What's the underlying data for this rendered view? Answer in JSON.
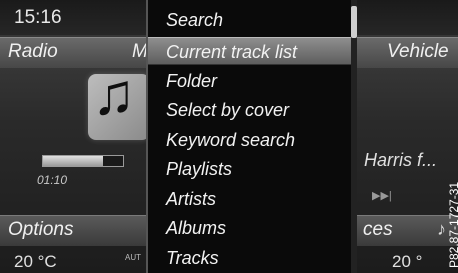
{
  "header": {
    "clock": "15:16"
  },
  "left_panel": {
    "title": "Radio",
    "title_partial": "M",
    "track_time": "01:10",
    "progress": 0.75,
    "options_label": "Options",
    "temperature": "20 °C",
    "auto_label": "AUT"
  },
  "menu": {
    "items": [
      {
        "label": "Search"
      },
      {
        "label": "Current track list",
        "selected": true
      },
      {
        "label": "Folder"
      },
      {
        "label": "Select by cover"
      },
      {
        "label": "Keyword search"
      },
      {
        "label": "Playlists"
      },
      {
        "label": "Artists"
      },
      {
        "label": "Albums"
      },
      {
        "label": "Tracks"
      }
    ]
  },
  "right_panel": {
    "title": "Vehicle",
    "track_artist": "Harris f...",
    "services_partial": "ces",
    "temperature": "20 °",
    "icons": {
      "skip": "skip-forward-icon",
      "music": "music-note-icon"
    }
  },
  "watermark": {
    "code": "P82.87-1727-31"
  }
}
